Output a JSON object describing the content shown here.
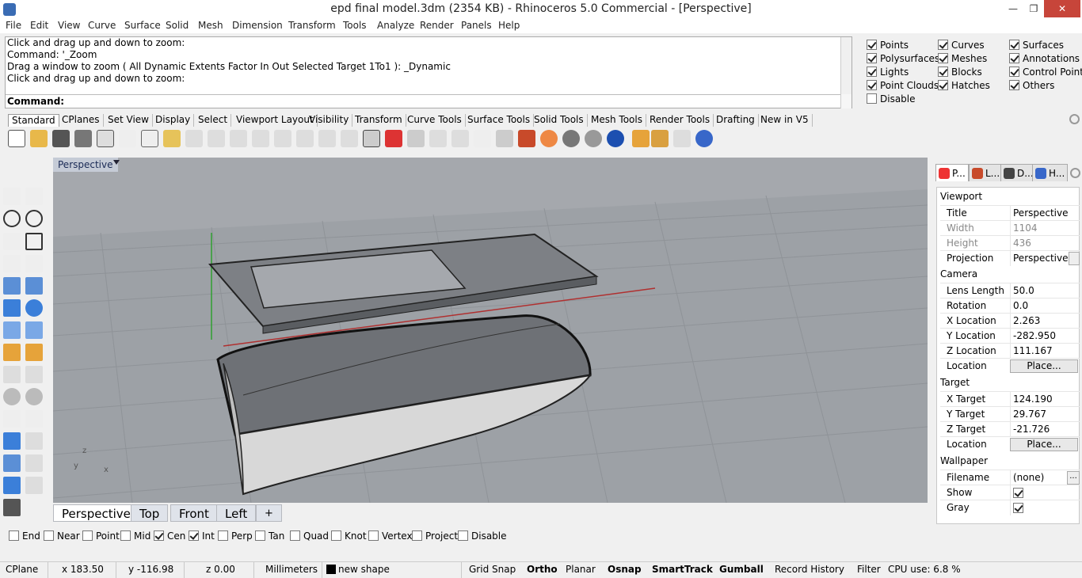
{
  "window": {
    "title": "epd final model.3dm (2354 KB) - Rhinoceros 5.0 Commercial - [Perspective]",
    "minimize": "—",
    "maximize": "❐",
    "close": "✕"
  },
  "menu": [
    "File",
    "Edit",
    "View",
    "Curve",
    "Surface",
    "Solid",
    "Mesh",
    "Dimension",
    "Transform",
    "Tools",
    "Analyze",
    "Render",
    "Panels",
    "Help"
  ],
  "command_history": [
    "Click and drag up and down to zoom:",
    "Command: '_Zoom",
    "Drag a window to zoom ( All  Dynamic  Extents  Factor  In  Out  Selected  Target  1To1 ): _Dynamic",
    "Click and drag up and down to zoom:"
  ],
  "command_prompt": "Command:",
  "select_filters": [
    {
      "label": "Points",
      "checked": true
    },
    {
      "label": "Curves",
      "checked": true
    },
    {
      "label": "Surfaces",
      "checked": true
    },
    {
      "label": "Polysurfaces",
      "checked": true
    },
    {
      "label": "Meshes",
      "checked": true
    },
    {
      "label": "Annotations",
      "checked": true
    },
    {
      "label": "Lights",
      "checked": true
    },
    {
      "label": "Blocks",
      "checked": true
    },
    {
      "label": "Control Points",
      "checked": true
    },
    {
      "label": "Point Clouds",
      "checked": true
    },
    {
      "label": "Hatches",
      "checked": true
    },
    {
      "label": "Others",
      "checked": true
    },
    {
      "label": "Disable",
      "checked": false
    }
  ],
  "toolbar_tabs": [
    "Standard",
    "CPlanes",
    "Set View",
    "Display",
    "Select",
    "Viewport Layout",
    "Visibility",
    "Transform",
    "Curve Tools",
    "Surface Tools",
    "Solid Tools",
    "Mesh Tools",
    "Render Tools",
    "Drafting",
    "New in V5"
  ],
  "toolbar_icons": [
    "new-file-icon",
    "open-folder-icon",
    "save-icon",
    "print-icon",
    "import-icon",
    "cut-icon",
    "copy-icon",
    "paste-icon",
    "undo-icon",
    "pan-hand-icon",
    "rotate-view-icon",
    "zoom-dynamic-icon",
    "zoom-window-icon",
    "zoom-extents-icon",
    "zoom-selected-icon",
    "rotate-camera-icon",
    "four-viewports-icon",
    "car-icon",
    "options-icon",
    "cplane-icon",
    "point-icon",
    "light-bulb-icon",
    "lock-icon",
    "layer-icon",
    "color-wheel-icon",
    "render-sphere-icon",
    "shaded-sphere-icon",
    "rendered-sphere-icon",
    "pencil-icon",
    "gear-settings-icon",
    "gumball-icon",
    "help-icon"
  ],
  "viewport": {
    "title": "Perspective"
  },
  "view_tabs": [
    "Perspective",
    "Top",
    "Front",
    "Left",
    "+"
  ],
  "osnaps": [
    {
      "label": "End",
      "checked": false
    },
    {
      "label": "Near",
      "checked": false
    },
    {
      "label": "Point",
      "checked": false
    },
    {
      "label": "Mid",
      "checked": false
    },
    {
      "label": "Cen",
      "checked": true
    },
    {
      "label": "Int",
      "checked": true
    },
    {
      "label": "Perp",
      "checked": false
    },
    {
      "label": "Tan",
      "checked": false
    },
    {
      "label": "Quad",
      "checked": false
    },
    {
      "label": "Knot",
      "checked": false
    },
    {
      "label": "Vertex",
      "checked": false
    },
    {
      "label": "Project",
      "checked": false
    },
    {
      "label": "Disable",
      "checked": false
    }
  ],
  "status": {
    "cplane": "CPlane",
    "x": "x 183.50",
    "y": "y -116.98",
    "z": "z 0.00",
    "units": "Millimeters",
    "layer": "new shape",
    "grid_snap": "Grid Snap",
    "ortho": "Ortho",
    "planar": "Planar",
    "osnap": "Osnap",
    "smarttrack": "SmartTrack",
    "gumball": "Gumball",
    "record_history": "Record History",
    "filter": "Filter",
    "cpu": "CPU use: 6.8 %"
  },
  "panel_tabs": [
    "P...",
    "L...",
    "D...",
    "H..."
  ],
  "properties": {
    "viewport_section": "Viewport",
    "title_label": "Title",
    "title_value": "Perspective",
    "width_label": "Width",
    "width_value": "1104",
    "height_label": "Height",
    "height_value": "436",
    "projection_label": "Projection",
    "projection_value": "Perspective",
    "camera_section": "Camera",
    "lens_label": "Lens Length",
    "lens_value": "50.0",
    "rotation_label": "Rotation",
    "rotation_value": "0.0",
    "xloc_label": "X Location",
    "xloc_value": "2.263",
    "yloc_label": "Y Location",
    "yloc_value": "-282.950",
    "zloc_label": "Z Location",
    "zloc_value": "111.167",
    "loc_label": "Location",
    "place_button": "Place...",
    "target_section": "Target",
    "xtarget_label": "X Target",
    "xtarget_value": "124.190",
    "ytarget_label": "Y Target",
    "ytarget_value": "29.767",
    "ztarget_label": "Z Target",
    "ztarget_value": "-21.726",
    "tloc_label": "Location",
    "tplace_button": "Place...",
    "wallpaper_section": "Wallpaper",
    "filename_label": "Filename",
    "filename_value": "(none)",
    "browse_button": "...",
    "show_label": "Show",
    "show_checked": true,
    "gray_label": "Gray",
    "gray_checked": true
  },
  "colors": {
    "viewport_bg": "#a5a8ad",
    "x_axis": "#b03030",
    "y_axis": "#30a030",
    "close_button": "#c7453a"
  }
}
